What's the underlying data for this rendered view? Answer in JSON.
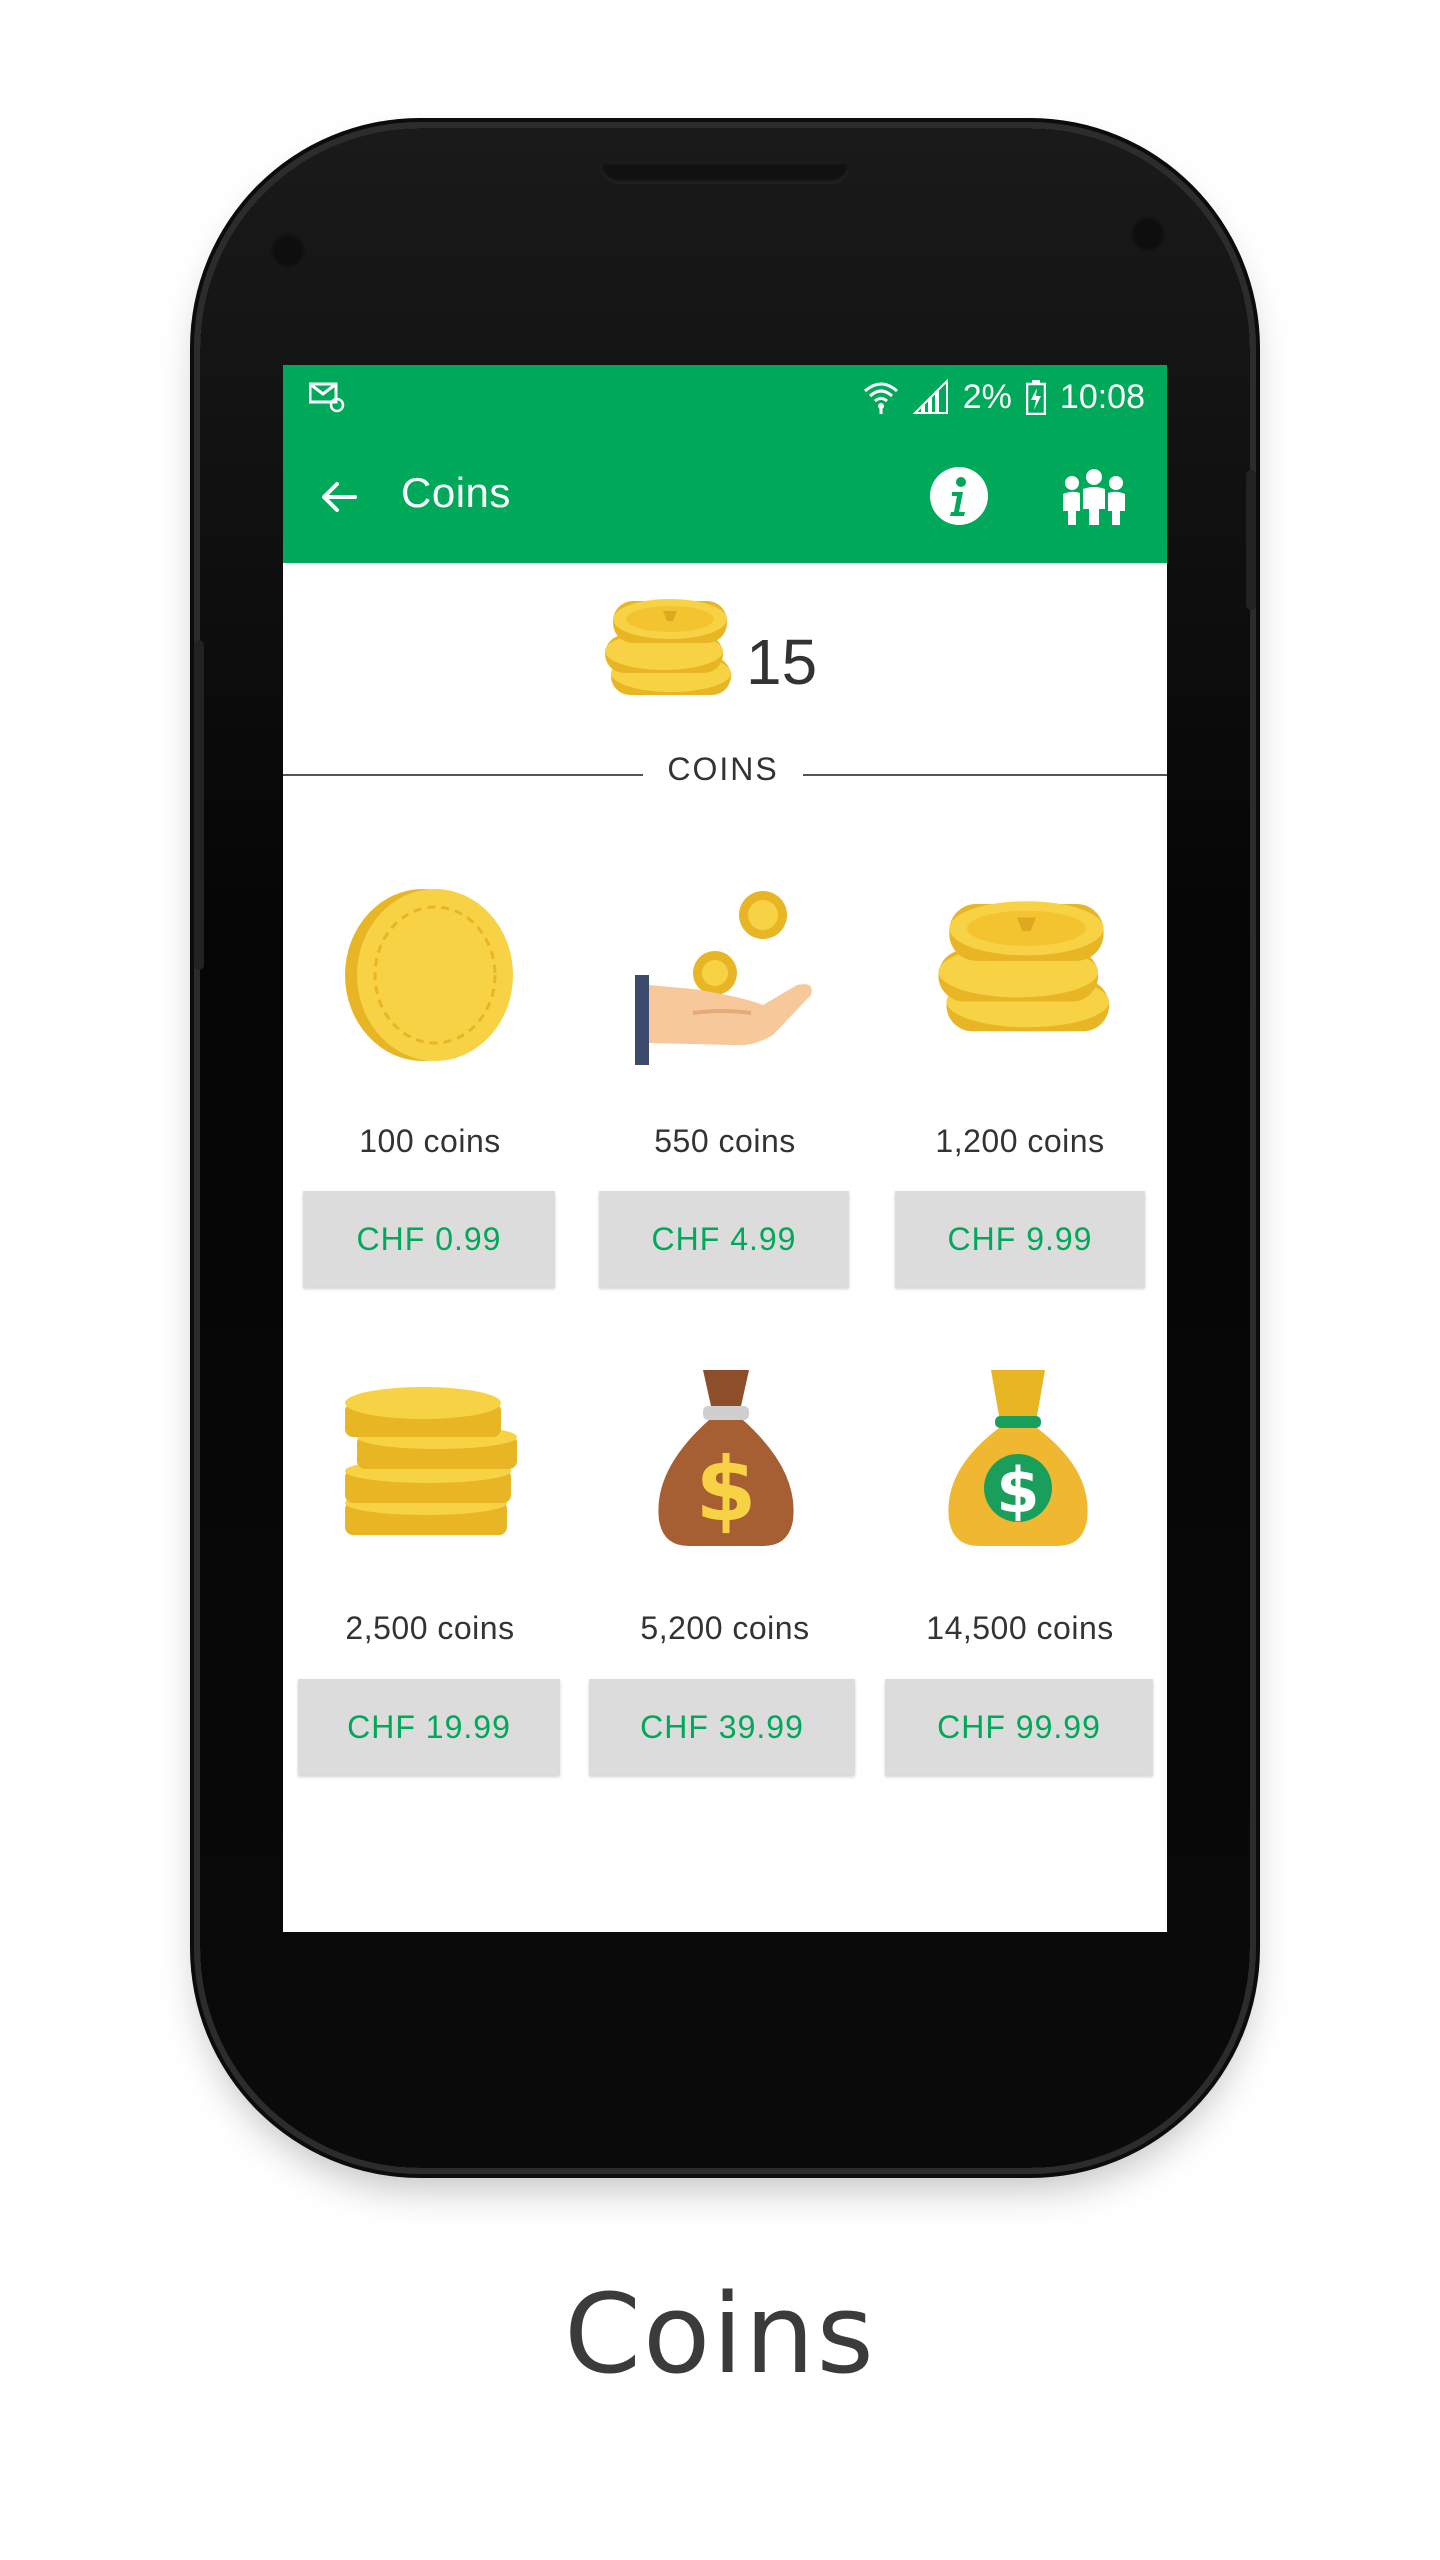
{
  "status_bar": {
    "battery": "2%",
    "time": "10:08"
  },
  "app_bar": {
    "title": "Coins"
  },
  "balance": {
    "value": "15"
  },
  "section": {
    "label": "COINS"
  },
  "packages": [
    {
      "coins": "100 coins",
      "price": "CHF 0.99",
      "icon": "single-coin-icon"
    },
    {
      "coins": "550 coins",
      "price": "CHF 4.99",
      "icon": "hand-coins-icon"
    },
    {
      "coins": "1,200 coins",
      "price": "CHF 9.99",
      "icon": "coin-pile-icon"
    },
    {
      "coins": "2,500 coins",
      "price": "CHF 19.99",
      "icon": "coin-stack-icon"
    },
    {
      "coins": "5,200 coins",
      "price": "CHF 39.99",
      "icon": "brown-money-bag-icon"
    },
    {
      "coins": "14,500 coins",
      "price": "CHF 99.99",
      "icon": "gold-money-bag-icon"
    }
  ],
  "caption": "Coins",
  "colors": {
    "accent": "#00a85a",
    "coin": "#f8d245",
    "coin_dark": "#e8b524",
    "button_bg": "#dcdcdc"
  }
}
